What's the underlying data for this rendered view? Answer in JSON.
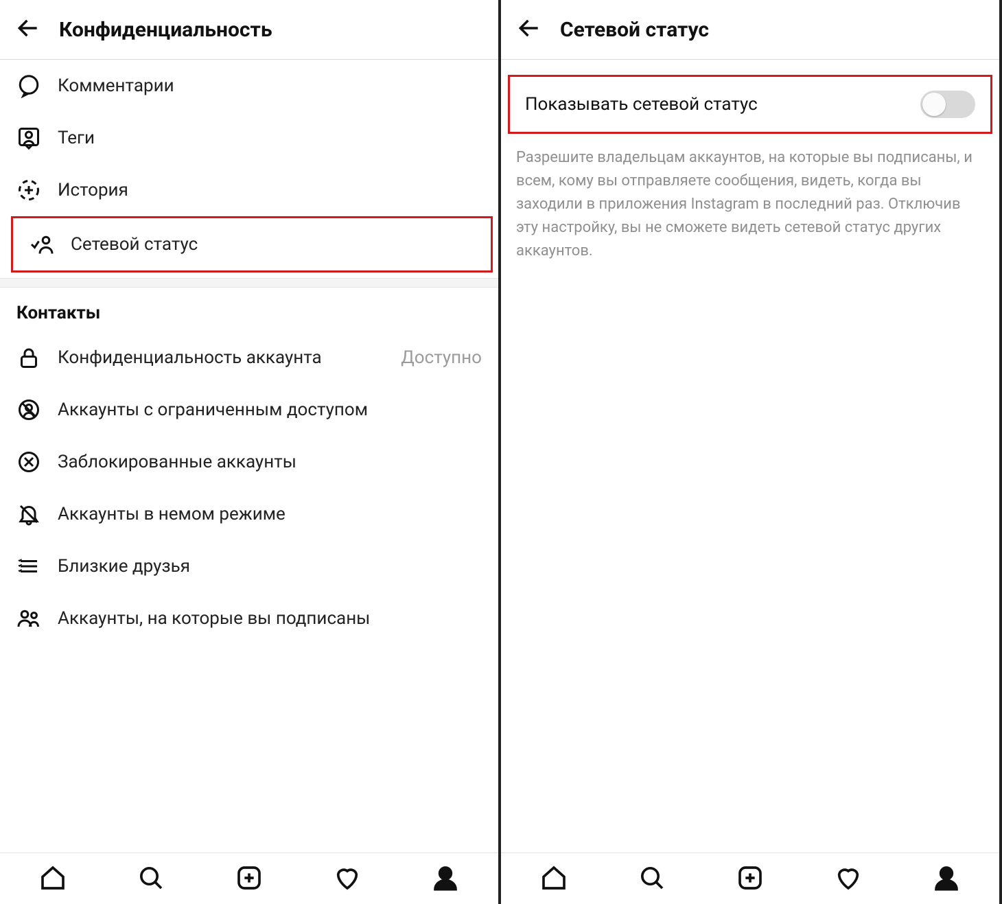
{
  "left": {
    "header": {
      "title": "Конфиденциальность"
    },
    "items": [
      {
        "label": "Комментарии"
      },
      {
        "label": "Теги"
      },
      {
        "label": "История"
      },
      {
        "label": "Сетевой статус"
      }
    ],
    "contactsTitle": "Контакты",
    "contacts": [
      {
        "label": "Конфиденциальность аккаунта",
        "trailing": "Доступно"
      },
      {
        "label": "Аккаунты с ограниченным доступом"
      },
      {
        "label": "Заблокированные аккаунты"
      },
      {
        "label": "Аккаунты в немом режиме"
      },
      {
        "label": "Близкие друзья"
      },
      {
        "label": "Аккаунты, на которые вы подписаны"
      }
    ]
  },
  "right": {
    "header": {
      "title": "Сетевой статус"
    },
    "toggleLabel": "Показывать сетевой статус",
    "toggleOn": false,
    "description": "Разрешите владельцам аккаунтов, на которые вы подписаны, и всем, кому вы отправляете сообщения, видеть, когда вы заходили в приложения Instagram в последний раз. Отключив эту настройку, вы не сможете видеть сетевой статус других аккаунтов."
  }
}
